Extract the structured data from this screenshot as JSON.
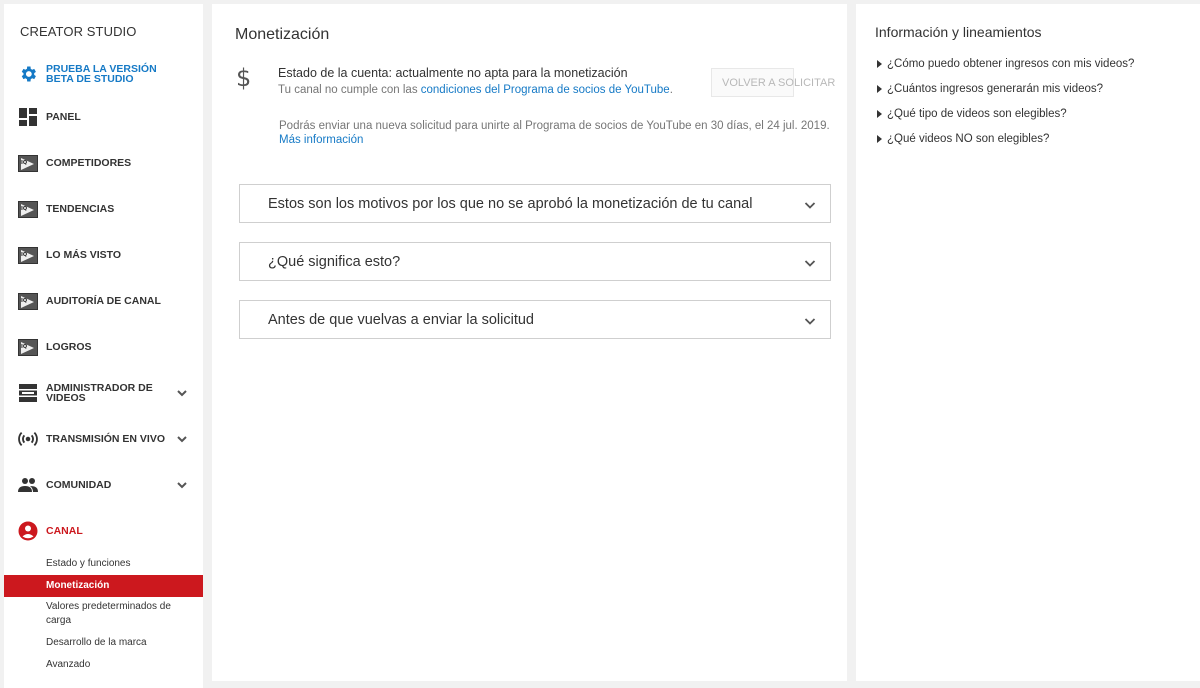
{
  "sidebar": {
    "title": "CREATOR STUDIO",
    "items": [
      {
        "label": "PRUEBA LA VERSIÓN BETA DE STUDIO",
        "icon": "gear-icon"
      },
      {
        "label": "PANEL",
        "icon": "dashboard-icon"
      },
      {
        "label": "COMPETIDORES",
        "icon": "tubebuddy-icon"
      },
      {
        "label": "TENDENCIAS",
        "icon": "tubebuddy-icon"
      },
      {
        "label": "LO MÁS VISTO",
        "icon": "tubebuddy-icon"
      },
      {
        "label": "AUDITORÍA DE CANAL",
        "icon": "tubebuddy-icon"
      },
      {
        "label": "LOGROS",
        "icon": "tubebuddy-icon"
      },
      {
        "label": "ADMINISTRADOR DE VIDEOS",
        "icon": "video-manager-icon"
      },
      {
        "label": "TRANSMISIÓN EN VIVO",
        "icon": "live-icon"
      },
      {
        "label": "COMUNIDAD",
        "icon": "people-icon"
      },
      {
        "label": "CANAL",
        "icon": "account-circle-icon"
      }
    ],
    "canal_subitems": [
      "Estado y funciones",
      "Monetización",
      "Valores predeterminados de carga",
      "Desarrollo de la marca",
      "Avanzado"
    ],
    "accent": "#cc181e",
    "link_color": "#167ac6"
  },
  "main": {
    "title": "Monetización",
    "status_title": "Estado de la cuenta: actualmente no apta para la monetización",
    "status_sub_prefix": "Tu canal no cumple con las ",
    "status_sub_link": "condiciones del Programa de socios de YouTube",
    "status_sub_suffix": ".",
    "reapply_label": "VOLVER A SOLICITAR",
    "notice": "Podrás enviar una nueva solicitud para unirte al Programa de socios de YouTube en 30 días, el 24 jul. 2019.",
    "more_info": "Más información",
    "accordions": [
      "Estos son los motivos por los que no se aprobó la monetización de tu canal",
      "¿Qué significa esto?",
      "Antes de que vuelvas a enviar la solicitud"
    ]
  },
  "info": {
    "title": "Información y lineamientos",
    "links": [
      "¿Cómo puedo obtener ingresos con mis videos?",
      "¿Cuántos ingresos generarán mis videos?",
      "¿Qué tipo de videos son elegibles?",
      "¿Qué videos NO son elegibles?"
    ]
  }
}
